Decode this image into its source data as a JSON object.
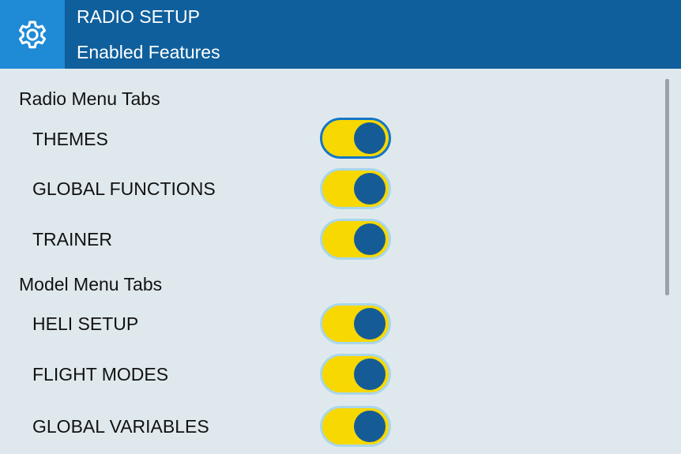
{
  "header": {
    "icon": "gear-icon",
    "title": "RADIO SETUP",
    "subtitle": "Enabled Features"
  },
  "sections": [
    {
      "title": "Radio Menu Tabs",
      "items": [
        {
          "label": "THEMES",
          "enabled": true,
          "focused": true
        },
        {
          "label": "GLOBAL FUNCTIONS",
          "enabled": true,
          "focused": false
        },
        {
          "label": "TRAINER",
          "enabled": true,
          "focused": false
        }
      ]
    },
    {
      "title": "Model Menu Tabs",
      "items": [
        {
          "label": "HELI SETUP",
          "enabled": true,
          "focused": false
        },
        {
          "label": "FLIGHT MODES",
          "enabled": true,
          "focused": false
        },
        {
          "label": "GLOBAL VARIABLES",
          "enabled": true,
          "focused": false
        }
      ]
    }
  ],
  "colors": {
    "header_bg": "#0f5f9c",
    "icon_box_bg": "#1f8ad6",
    "page_bg": "#dfe9ed",
    "toggle_on": "#f7d800",
    "toggle_knob": "#155c96",
    "focus_border": "#1476c7"
  }
}
